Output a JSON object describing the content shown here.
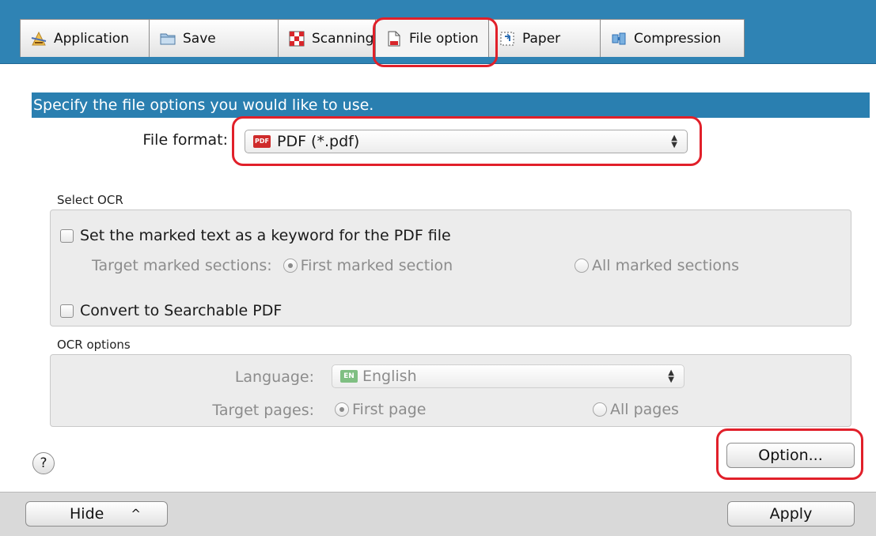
{
  "tabs": [
    {
      "label": "Application",
      "icon": "application-icon"
    },
    {
      "label": "Save",
      "icon": "folder-icon"
    },
    {
      "label": "Scanning",
      "icon": "scanning-icon"
    },
    {
      "label": "File option",
      "icon": "file-icon",
      "active": true
    },
    {
      "label": "Paper",
      "icon": "paper-icon"
    },
    {
      "label": "Compression",
      "icon": "compression-icon"
    }
  ],
  "banner": "Specify the file options you would like to use.",
  "file_format": {
    "label": "File format:",
    "badge": "PDF",
    "value": "PDF (*.pdf)"
  },
  "select_ocr": {
    "label": "Select OCR",
    "keyword_checkbox": "Set the marked text as a keyword for the PDF file",
    "target_label": "Target marked sections:",
    "first_marked": "First marked section",
    "all_marked": "All marked sections",
    "searchable_checkbox": "Convert to Searchable PDF"
  },
  "ocr_options": {
    "label": "OCR options",
    "language_label": "Language:",
    "language_badge": "EN",
    "language_value": "English",
    "target_pages_label": "Target pages:",
    "first_page": "First page",
    "all_pages": "All pages"
  },
  "buttons": {
    "help": "?",
    "option": "Option...",
    "hide": "Hide",
    "hide_chevron": "^",
    "apply": "Apply"
  },
  "colors": {
    "tab_bar": "#2f83b4",
    "banner": "#2a7fb0",
    "highlight": "#e1202a"
  }
}
